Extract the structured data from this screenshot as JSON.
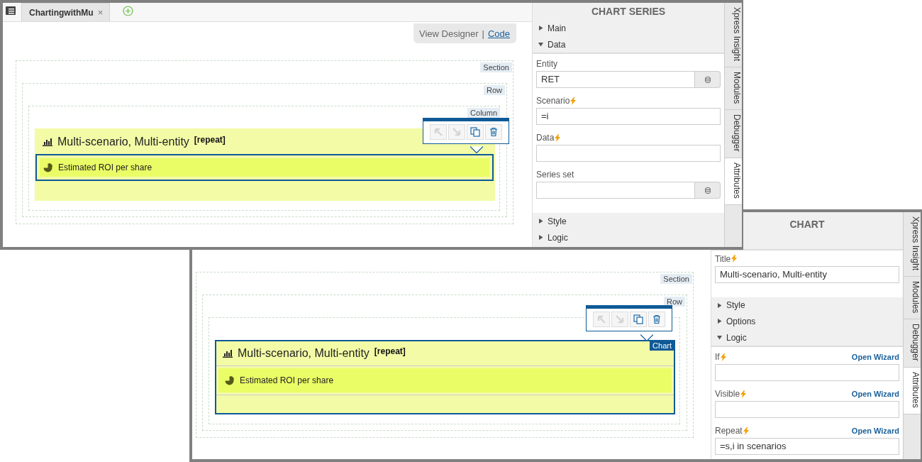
{
  "windows": [
    {
      "document_tab": {
        "label": "ChartingwithMu",
        "close": "×"
      },
      "view_switch": {
        "designer": "View Designer",
        "separator": "|",
        "code": "Code"
      },
      "canvas": {
        "section_label": "Section",
        "row_label": "Row",
        "column_label": "Column",
        "chart": {
          "title": "Multi-scenario, Multi-entity",
          "tag": "[repeat]",
          "selected": false,
          "series": [
            {
              "label": "Estimated ROI per share",
              "selected": true
            }
          ]
        },
        "toolbar": [
          {
            "kind": "move-up",
            "disabled": true
          },
          {
            "kind": "move-down",
            "disabled": true
          },
          {
            "kind": "copy",
            "disabled": false
          },
          {
            "kind": "delete",
            "disabled": false
          }
        ]
      },
      "panel": {
        "title": "CHART SERIES",
        "items": [
          {
            "kind": "group",
            "label": "Main",
            "expanded": false
          },
          {
            "kind": "group",
            "label": "Data",
            "expanded": true
          },
          {
            "kind": "field",
            "label": "Entity",
            "dynamic": false,
            "value": "RET",
            "picker": true
          },
          {
            "kind": "field",
            "label": "Scenario",
            "dynamic": true,
            "value": "=i",
            "picker": false
          },
          {
            "kind": "field",
            "label": "Data",
            "dynamic": true,
            "picker": false
          },
          {
            "kind": "field",
            "label": "Series set",
            "dynamic": false,
            "picker": true
          },
          {
            "kind": "group",
            "label": "Style",
            "expanded": false
          },
          {
            "kind": "group",
            "label": "Logic",
            "expanded": false
          }
        ]
      },
      "side_tabs": [
        {
          "label": "Xpress Insight",
          "selected": false
        },
        {
          "label": "Modules",
          "selected": false
        },
        {
          "label": "Debugger",
          "selected": false
        },
        {
          "label": "Attributes",
          "selected": true
        }
      ]
    },
    {
      "canvas": {
        "section_label": "Section",
        "row_label": "Row",
        "chart": {
          "title": "Multi-scenario, Multi-entity",
          "tag": "[repeat]",
          "selected": true,
          "badge": "Chart",
          "series": [
            {
              "label": "Estimated ROI per share",
              "selected": false
            }
          ]
        },
        "toolbar": [
          {
            "kind": "move-up",
            "disabled": true
          },
          {
            "kind": "move-down",
            "disabled": true
          },
          {
            "kind": "copy",
            "disabled": false
          },
          {
            "kind": "delete",
            "disabled": false
          }
        ]
      },
      "panel": {
        "title": "CHART",
        "items": [
          {
            "kind": "field",
            "label": "Title",
            "dynamic": true,
            "value": "Multi-scenario, Multi-entity",
            "picker": false
          },
          {
            "kind": "group",
            "label": "Style",
            "expanded": false
          },
          {
            "kind": "group",
            "label": "Options",
            "expanded": false
          },
          {
            "kind": "group",
            "label": "Logic",
            "expanded": true
          },
          {
            "kind": "field",
            "label": "If",
            "dynamic": true,
            "wizard": "Open Wizard",
            "picker": false
          },
          {
            "kind": "field",
            "label": "Visible",
            "dynamic": true,
            "wizard": "Open Wizard",
            "picker": false
          },
          {
            "kind": "field",
            "label": "Repeat",
            "dynamic": true,
            "wizard": "Open Wizard",
            "value": "=s,i in scenarios",
            "picker": false
          }
        ]
      },
      "side_tabs": [
        {
          "label": "Xpress Insight",
          "selected": false
        },
        {
          "label": "Modules",
          "selected": false
        },
        {
          "label": "Debugger",
          "selected": false
        },
        {
          "label": "Attributes",
          "selected": true
        }
      ]
    }
  ]
}
